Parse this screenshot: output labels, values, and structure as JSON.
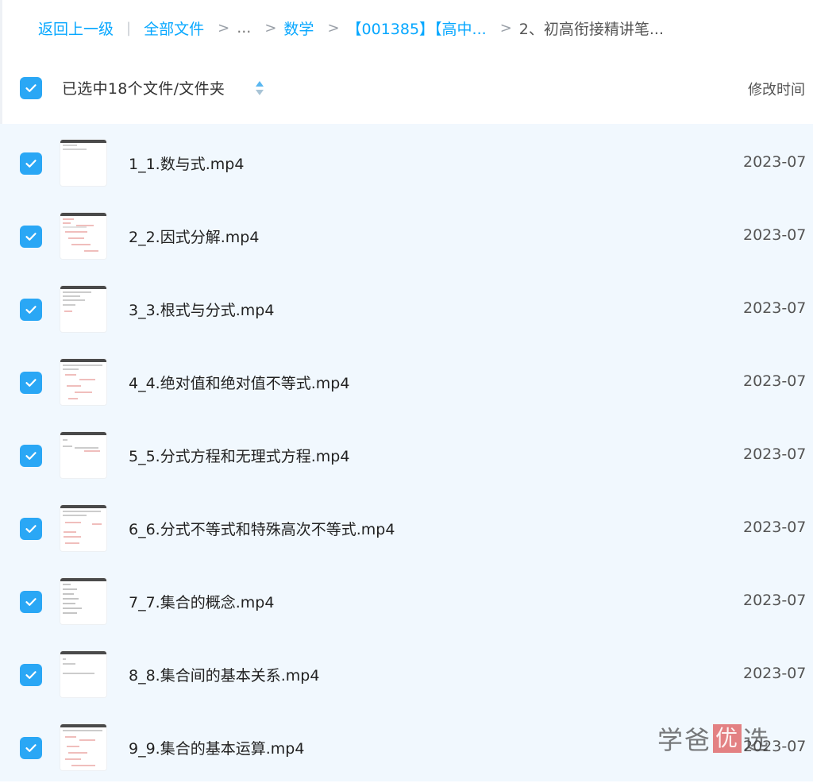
{
  "breadcrumb": {
    "back": "返回上一级",
    "all_files": "全部文件",
    "ellipsis": "...",
    "math": "数学",
    "course_prefix": "【001385】【高中...",
    "current": "2、初高衔接精讲笔..."
  },
  "header": {
    "selection_label": "已选中18个文件/文件夹",
    "modified_time": "修改时间"
  },
  "files": [
    {
      "name": "1_1.数与式.mp4",
      "date": "2023-07"
    },
    {
      "name": "2_2.因式分解.mp4",
      "date": "2023-07"
    },
    {
      "name": "3_3.根式与分式.mp4",
      "date": "2023-07"
    },
    {
      "name": "4_4.绝对值和绝对值不等式.mp4",
      "date": "2023-07"
    },
    {
      "name": "5_5.分式方程和无理式方程.mp4",
      "date": "2023-07"
    },
    {
      "name": "6_6.分式不等式和特殊高次不等式.mp4",
      "date": "2023-07"
    },
    {
      "name": "7_7.集合的概念.mp4",
      "date": "2023-07"
    },
    {
      "name": "8_8.集合间的基本关系.mp4",
      "date": "2023-07"
    },
    {
      "name": "9_9.集合的基本运算.mp4",
      "date": "2023-07"
    }
  ],
  "watermark": {
    "part1": "学爸",
    "part2": "优",
    "part3": "选"
  },
  "colors": {
    "accent": "#06a7ff",
    "checkbox": "#2aa7f5",
    "list_bg": "#f1f8fe"
  }
}
